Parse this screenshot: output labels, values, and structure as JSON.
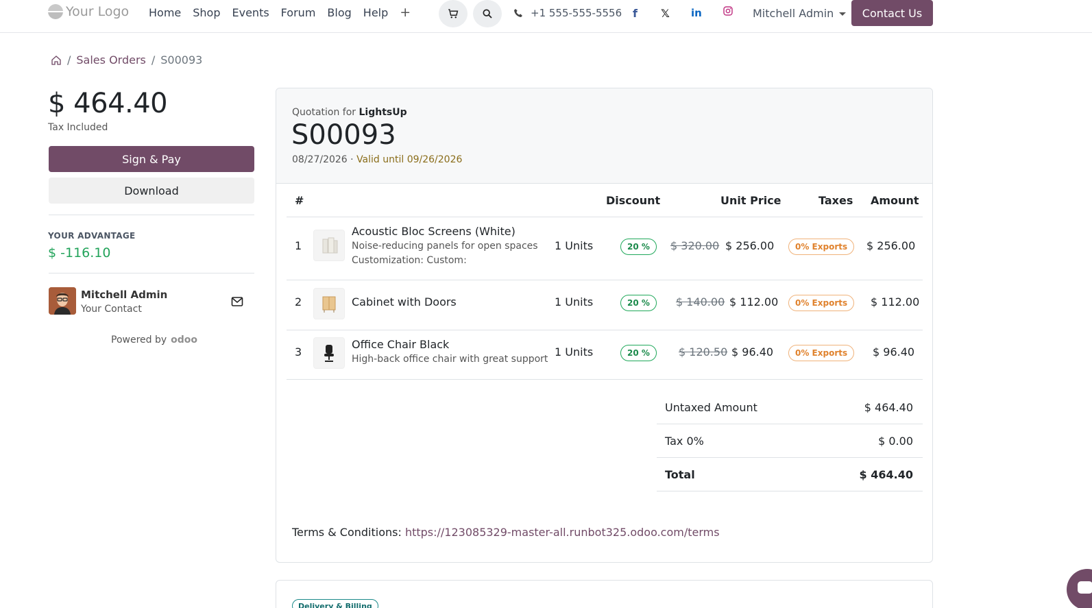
{
  "header": {
    "logo_text": "Your Logo",
    "nav": [
      "Home",
      "Shop",
      "Events",
      "Forum",
      "Blog",
      "Help"
    ],
    "nav_more": "+",
    "phone": "+1 555-555-5556",
    "user": "Mitchell Admin",
    "contact_label": "Contact Us",
    "socials": [
      "facebook-icon",
      "x-twitter-icon",
      "linkedin-icon",
      "instagram-icon"
    ]
  },
  "breadcrumb": {
    "parent": "Sales Orders",
    "current": "S00093"
  },
  "summary": {
    "total": "$ 464.40",
    "tax_note": "Tax Included",
    "sign_label": "Sign & Pay",
    "download_label": "Download",
    "advantage_label": "YOUR ADVANTAGE",
    "advantage_value": "$ -116.10",
    "contact_name": "Mitchell Admin",
    "contact_role": "Your Contact",
    "powered_by": "Powered by",
    "powered_brand": "odoo"
  },
  "quote": {
    "prefix": "Quotation for",
    "customer": "LightsUp",
    "number": "S00093",
    "date": "08/27/2026",
    "separator": "·",
    "valid_until": "Valid until 09/26/2026",
    "columns": {
      "num": "#",
      "discount": "Discount",
      "unit_price": "Unit Price",
      "taxes": "Taxes",
      "amount": "Amount"
    },
    "lines": [
      {
        "num": "1",
        "name": "Acoustic Bloc Screens (White)",
        "desc1": "Noise-reducing panels for open spaces",
        "desc2": "Customization: Custom:",
        "qty": "1 Units",
        "discount": "20 %",
        "old_price": "$ 320.00",
        "price": "$ 256.00",
        "tax": "0% Exports",
        "amount": "$ 256.00"
      },
      {
        "num": "2",
        "name": "Cabinet with Doors",
        "desc1": "",
        "desc2": "",
        "qty": "1 Units",
        "discount": "20 %",
        "old_price": "$ 140.00",
        "price": "$ 112.00",
        "tax": "0% Exports",
        "amount": "$ 112.00"
      },
      {
        "num": "3",
        "name": "Office Chair Black",
        "desc1": "High-back office chair with great support",
        "desc2": "",
        "qty": "1 Units",
        "discount": "20 %",
        "old_price": "$ 120.50",
        "price": "$ 96.40",
        "tax": "0% Exports",
        "amount": "$ 96.40"
      }
    ],
    "totals": {
      "untaxed_label": "Untaxed Amount",
      "untaxed_value": "$ 464.40",
      "tax_label": "Tax 0%",
      "tax_value": "$ 0.00",
      "total_label": "Total",
      "total_value": "$ 464.40"
    },
    "terms_label": "Terms & Conditions:",
    "terms_url": "https://123085329-master-all.runbot325.odoo.com/terms"
  },
  "section2": {
    "badge": "Delivery & Billing"
  },
  "colors": {
    "brand": "#714b67",
    "success": "#22a35a",
    "warning": "#e0822d"
  }
}
